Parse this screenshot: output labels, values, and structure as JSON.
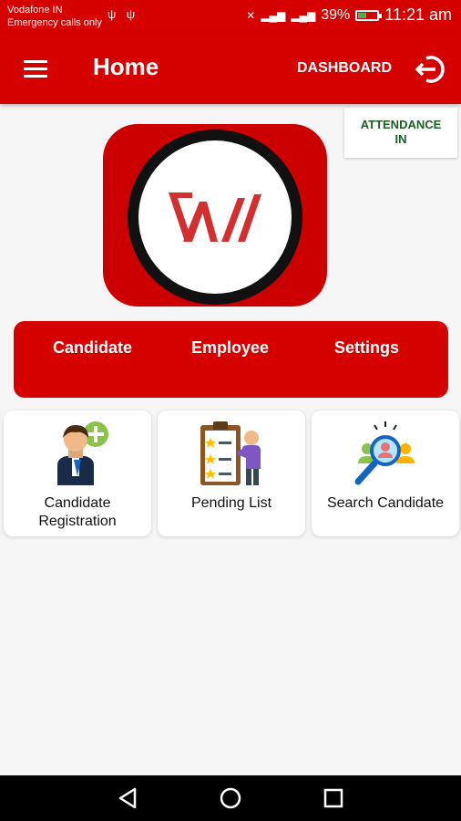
{
  "status": {
    "carrier_line1": "Vodafone IN",
    "carrier_line2": "Emergency calls only",
    "battery": "39%",
    "battery_level": 0.39,
    "time": "11:21 am"
  },
  "app_bar": {
    "title": "Home",
    "dashboard_label": "DASHBOARD"
  },
  "attendance": {
    "line1": "ATTENDANCE",
    "line2": "IN"
  },
  "tabs": [
    {
      "label": "Candidate"
    },
    {
      "label": "Employee"
    },
    {
      "label": "Settings"
    }
  ],
  "cards": [
    {
      "line1": "Candidate",
      "line2": "Registration"
    },
    {
      "line1": "Pending List"
    },
    {
      "line1": "Search Candidate"
    }
  ],
  "colors": {
    "primary": "#d50000",
    "attendance_text": "#1b5e20"
  }
}
